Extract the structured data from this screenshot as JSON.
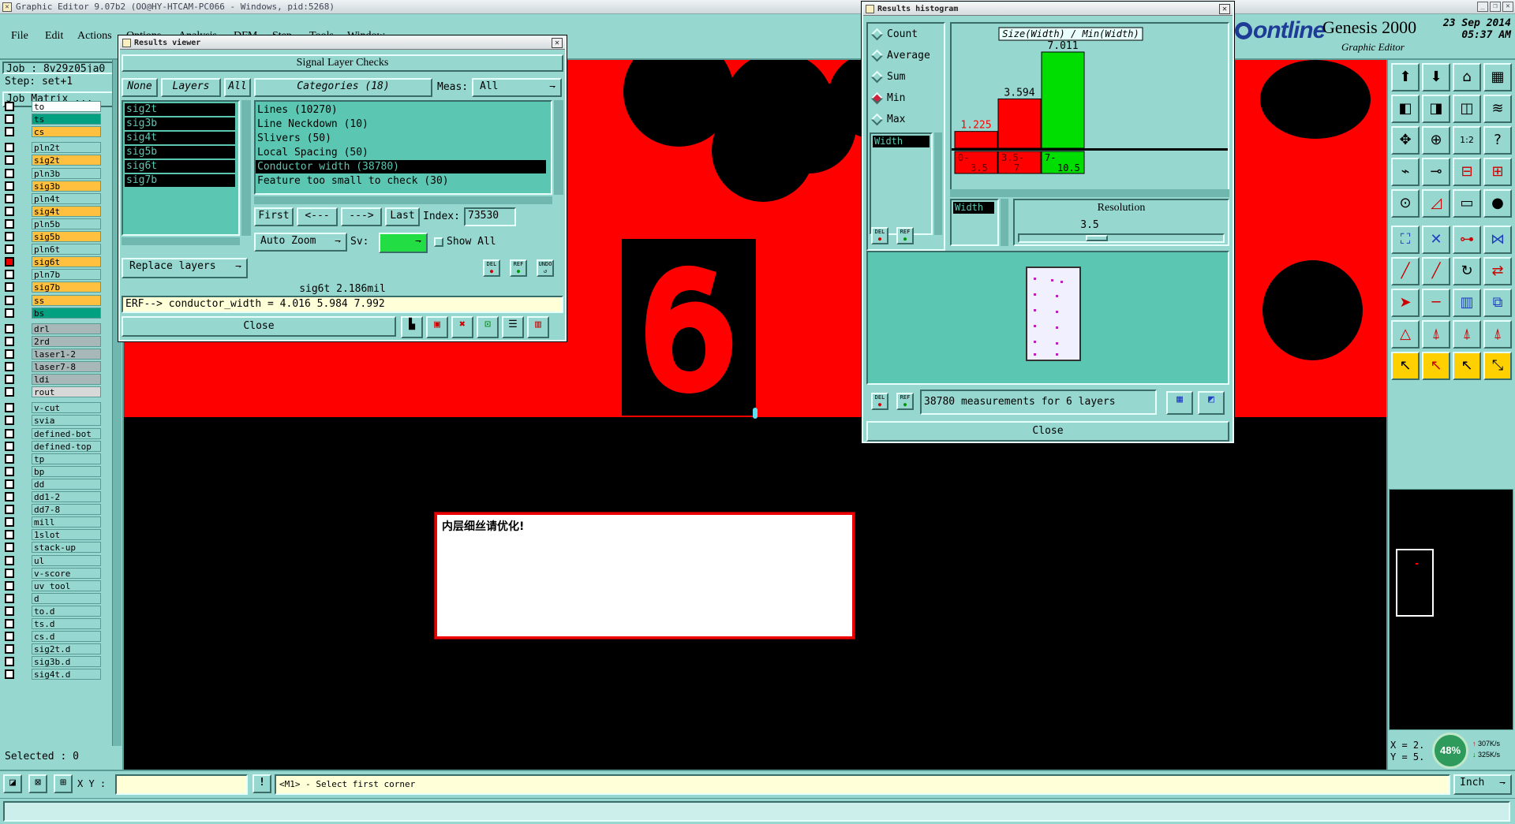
{
  "window": {
    "title": "Graphic Editor 9.07b2 (OO@HY-HTCAM-PC066 - Windows, pid:5268)"
  },
  "menu": [
    "File",
    "Edit",
    "Actions",
    "Options",
    "Analysis",
    "DFM",
    "Step",
    "Tools",
    "Window"
  ],
  "brand": {
    "logo": "ontline",
    "product": "Genesis 2000",
    "subtitle": "Graphic Editor",
    "date": "23 Sep 2014",
    "time": "05:37 AM"
  },
  "job": {
    "job_label": "Job : 8v29z05ja0",
    "step_label": "Step: set+1",
    "matrix_label": "Job Matrix ...",
    "selected": "Selected : 0"
  },
  "layers": [
    {
      "name": "to",
      "color": "#ffffff"
    },
    {
      "name": "ts",
      "color": "#00a080"
    },
    {
      "name": "cs",
      "color": "#ffc040"
    },
    {
      "name": "pln2t",
      "color": "#96d7d0"
    },
    {
      "name": "sig2t",
      "color": "#ffc040"
    },
    {
      "name": "pln3b",
      "color": "#96d7d0"
    },
    {
      "name": "sig3b",
      "color": "#ffc040"
    },
    {
      "name": "pln4t",
      "color": "#96d7d0"
    },
    {
      "name": "sig4t",
      "color": "#ffc040"
    },
    {
      "name": "pln5b",
      "color": "#96d7d0"
    },
    {
      "name": "sig5b",
      "color": "#ffc040"
    },
    {
      "name": "pln6t",
      "color": "#96d7d0"
    },
    {
      "name": "sig6t",
      "color": "#ffc040",
      "active": true
    },
    {
      "name": "pln7b",
      "color": "#96d7d0"
    },
    {
      "name": "sig7b",
      "color": "#ffc040"
    },
    {
      "name": "ss",
      "color": "#ffc040"
    },
    {
      "name": "bs",
      "color": "#00a080"
    },
    {
      "name": "drl",
      "color": "#a8b8b8"
    },
    {
      "name": "2rd",
      "color": "#a8b8b8"
    },
    {
      "name": "laser1-2",
      "color": "#a8b8b8"
    },
    {
      "name": "laser7-8",
      "color": "#a8b8b8"
    },
    {
      "name": "ldi",
      "color": "#a8b8b8"
    },
    {
      "name": "rout",
      "color": "#d8d8d8"
    },
    {
      "name": "v-cut",
      "color": "#96d7d0"
    },
    {
      "name": "svia",
      "color": "#96d7d0"
    },
    {
      "name": "defined-bot",
      "color": "#96d7d0"
    },
    {
      "name": "defined-top",
      "color": "#96d7d0"
    },
    {
      "name": "tp",
      "color": "#96d7d0"
    },
    {
      "name": "bp",
      "color": "#96d7d0"
    },
    {
      "name": "dd",
      "color": "#96d7d0"
    },
    {
      "name": "dd1-2",
      "color": "#96d7d0"
    },
    {
      "name": "dd7-8",
      "color": "#96d7d0"
    },
    {
      "name": "mill",
      "color": "#96d7d0"
    },
    {
      "name": "1slot",
      "color": "#96d7d0"
    },
    {
      "name": "stack-up",
      "color": "#96d7d0"
    },
    {
      "name": "ul",
      "color": "#96d7d0"
    },
    {
      "name": "v-score",
      "color": "#96d7d0"
    },
    {
      "name": "uv_tool",
      "color": "#96d7d0"
    },
    {
      "name": "d",
      "color": "#96d7d0"
    },
    {
      "name": "to.d",
      "color": "#96d7d0"
    },
    {
      "name": "ts.d",
      "color": "#96d7d0"
    },
    {
      "name": "cs.d",
      "color": "#96d7d0"
    },
    {
      "name": "sig2t.d",
      "color": "#96d7d0"
    },
    {
      "name": "sig3b.d",
      "color": "#96d7d0"
    },
    {
      "name": "sig4t.d",
      "color": "#96d7d0"
    }
  ],
  "results_viewer": {
    "title": "Results viewer",
    "header": "Signal Layer Checks",
    "none_btn": "None",
    "layers_btn": "Layers",
    "all_btn": "All",
    "categories_label": "Categories (18)",
    "meas_label": "Meas:",
    "meas_value": "All",
    "layer_list": [
      "sig2t",
      "sig3b",
      "sig4t",
      "sig5b",
      "sig6t",
      "sig7b"
    ],
    "categories": [
      {
        "text": "Lines (10270)"
      },
      {
        "text": "Line Neckdown (10)"
      },
      {
        "text": "Slivers (50)"
      },
      {
        "text": "Local Spacing (50)"
      },
      {
        "text": "Conductor width (38780)",
        "selected": true
      },
      {
        "text": "Feature too small to check (30)"
      }
    ],
    "first": "First",
    "prev": "<---",
    "next": "--->",
    "last": "Last",
    "index_label": "Index:",
    "index_value": "73530",
    "auto_zoom": "Auto Zoom",
    "sv_label": "Sv:",
    "show_all": "Show All",
    "replace_layers": "Replace layers",
    "btn_del": "DEL",
    "btn_ref": "REF",
    "btn_undo": "UNDO",
    "info": "sig6t 2.186mil",
    "erf": "ERF--> conductor_width = 4.016 5.984 7.992",
    "close": "Close"
  },
  "histogram": {
    "title": "Results histogram",
    "radios": [
      {
        "label": "Count",
        "on": false
      },
      {
        "label": "Average",
        "on": false
      },
      {
        "label": "Sum",
        "on": false
      },
      {
        "label": "Min",
        "on": true
      },
      {
        "label": "Max",
        "on": false
      }
    ],
    "width_item": "Width",
    "width_item2": "Width",
    "chart_title": "Size(Width) / Min(Width)",
    "resolution_label": "Resolution",
    "resolution_value": "3.5",
    "btn_del": "DEL",
    "btn_ref": "REF",
    "measurements": "38780 measurements for 6 layers",
    "close": "Close"
  },
  "chart_data": {
    "type": "bar",
    "title": "Size(Width) / Min(Width)",
    "categories": [
      "0-3.5",
      "3.5-7",
      "7-10.5"
    ],
    "values": [
      1.225,
      3.594,
      7.011
    ],
    "colors": [
      "#ff0000",
      "#ff0000",
      "#00dd00"
    ],
    "ylim": [
      0,
      7.011
    ]
  },
  "message": {
    "text": "内层细丝请优化!"
  },
  "status": {
    "xy_label": "X Y :",
    "xy_value": "",
    "prompt": "<M1> - Select first corner",
    "units": "Inch",
    "x_readout": "X = 2.",
    "y_readout": "Y = 5.",
    "net_percent": "48%",
    "net_up": "307K/s",
    "net_down": "325K/s"
  },
  "colors": {
    "panel": "#96d7d0",
    "field": "#5bc7b2",
    "copper": "#ff0000",
    "accent": "#00dd00"
  }
}
